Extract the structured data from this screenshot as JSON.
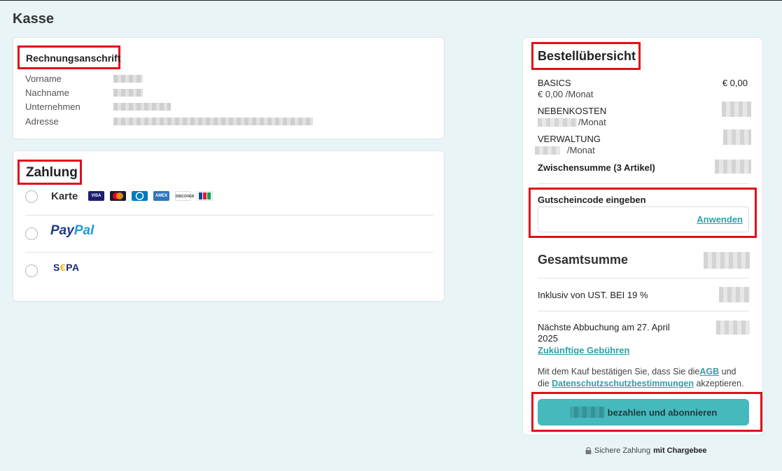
{
  "page_title": "Kasse",
  "billing": {
    "title": "Rechnungsanschrift",
    "fields": [
      {
        "label": "Vorname"
      },
      {
        "label": "Nachname"
      },
      {
        "label": "Unternehmen"
      },
      {
        "label": "Adresse"
      }
    ]
  },
  "payment": {
    "title": "Zahlung",
    "card_label": "Karte",
    "card_brands": [
      "VISA",
      "Mastercard",
      "Diners",
      "AMEX",
      "DISCOVER",
      "JCB"
    ],
    "paypal": {
      "part1": "Pay",
      "part2": "Pal"
    },
    "sepa": {
      "s": "S",
      "e": "€",
      "pa": "PA"
    }
  },
  "summary": {
    "title": "Bestellübersicht",
    "items": [
      {
        "name": "BASICS",
        "price": "€ 0,00",
        "sub_price": "€ 0,00",
        "sub_unit": "/Monat"
      },
      {
        "name": "NEBENKOSTEN",
        "sub_unit": "/Monat"
      },
      {
        "name": "VERWALTUNG",
        "sub_unit": "/Monat"
      }
    ],
    "subtotal_label": "Zwischensumme (3 Artikel)",
    "coupon": {
      "label": "Gutscheincode eingeben",
      "apply": "Anwenden"
    },
    "total_label": "Gesamtsumme",
    "tax_label": "Inklusiv von UST. BEI 19 %",
    "next_charge": "Nächste Abbuchung am 27. April 2025",
    "future_fees": "Zukünftige Gebühren",
    "terms_pre": "Mit dem Kauf bestätigen Sie, dass Sie die",
    "terms_agb": "AGB",
    "terms_mid": " und die ",
    "terms_privacy": "Datenschutzschutzbestimmungen",
    "terms_post": " akzeptieren.",
    "pay_button": "bezahlen und abonnieren"
  },
  "footer": {
    "secure": "Sichere Zahlung",
    "provider": "mit Chargebee"
  },
  "colors": {
    "accent": "#46b9bd",
    "link": "#2f9fa6",
    "highlight": "#e0101a",
    "background": "#e8f4f6"
  }
}
